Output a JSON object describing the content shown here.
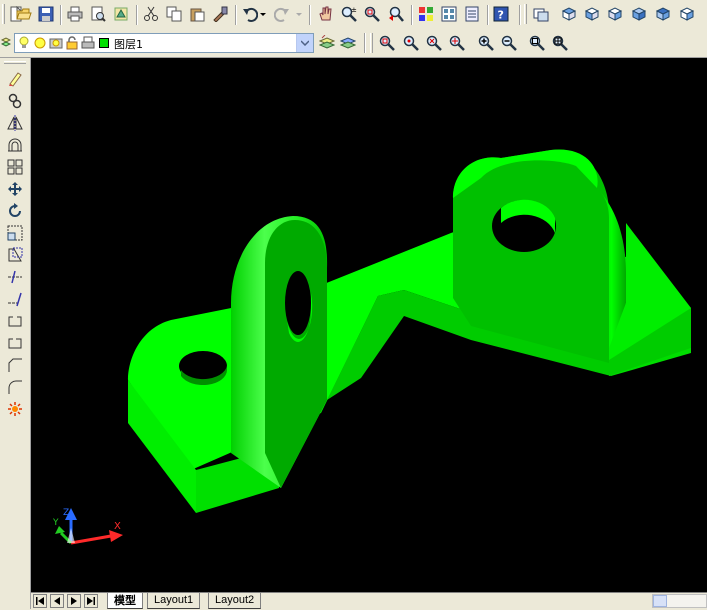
{
  "layer": {
    "name": "图层1",
    "swatch_color": "#00e000"
  },
  "viewport": {
    "background": "#000000",
    "model_color": "#00ff00"
  },
  "ucs": {
    "x_label": "X",
    "y_label": "Y",
    "z_label": "Z"
  },
  "tabs": [
    {
      "label": "模型",
      "active": true
    },
    {
      "label": "Layout1",
      "active": false
    },
    {
      "label": "Layout2",
      "active": false
    }
  ],
  "toolbar_top": {
    "icons": [
      "new-icon",
      "open-icon",
      "save-icon",
      "print-icon",
      "print-preview-icon",
      "publish-icon",
      "cut-icon",
      "copy-icon",
      "paste-icon",
      "match-properties-icon",
      "undo-icon",
      "redo-icon",
      "pan-icon",
      "zoom-realtime-icon",
      "zoom-window-icon",
      "zoom-previous-icon",
      "properties-icon",
      "design-center-icon",
      "tool-palettes-icon",
      "help-icon",
      "named-views-icon",
      "view-top-icon",
      "view-front-icon",
      "view-left-icon",
      "view-iso-icon",
      "view-iso-2-icon"
    ]
  },
  "toolbar_zoom": {
    "icons": [
      "zoom-window-icon",
      "zoom-dynamic-icon",
      "zoom-scale-icon",
      "zoom-center-icon",
      "zoom-in-icon",
      "zoom-out-icon",
      "zoom-all-icon",
      "zoom-extents-icon"
    ]
  },
  "toolbar_modify": {
    "icons": [
      "erase-icon",
      "copy-object-icon",
      "mirror-icon",
      "offset-icon",
      "array-icon",
      "move-icon",
      "rotate-icon",
      "scale-icon",
      "stretch-icon",
      "trim-icon",
      "extend-icon",
      "break-icon",
      "break-at-point-icon",
      "chamfer-icon",
      "fillet-icon",
      "explode-icon"
    ]
  }
}
